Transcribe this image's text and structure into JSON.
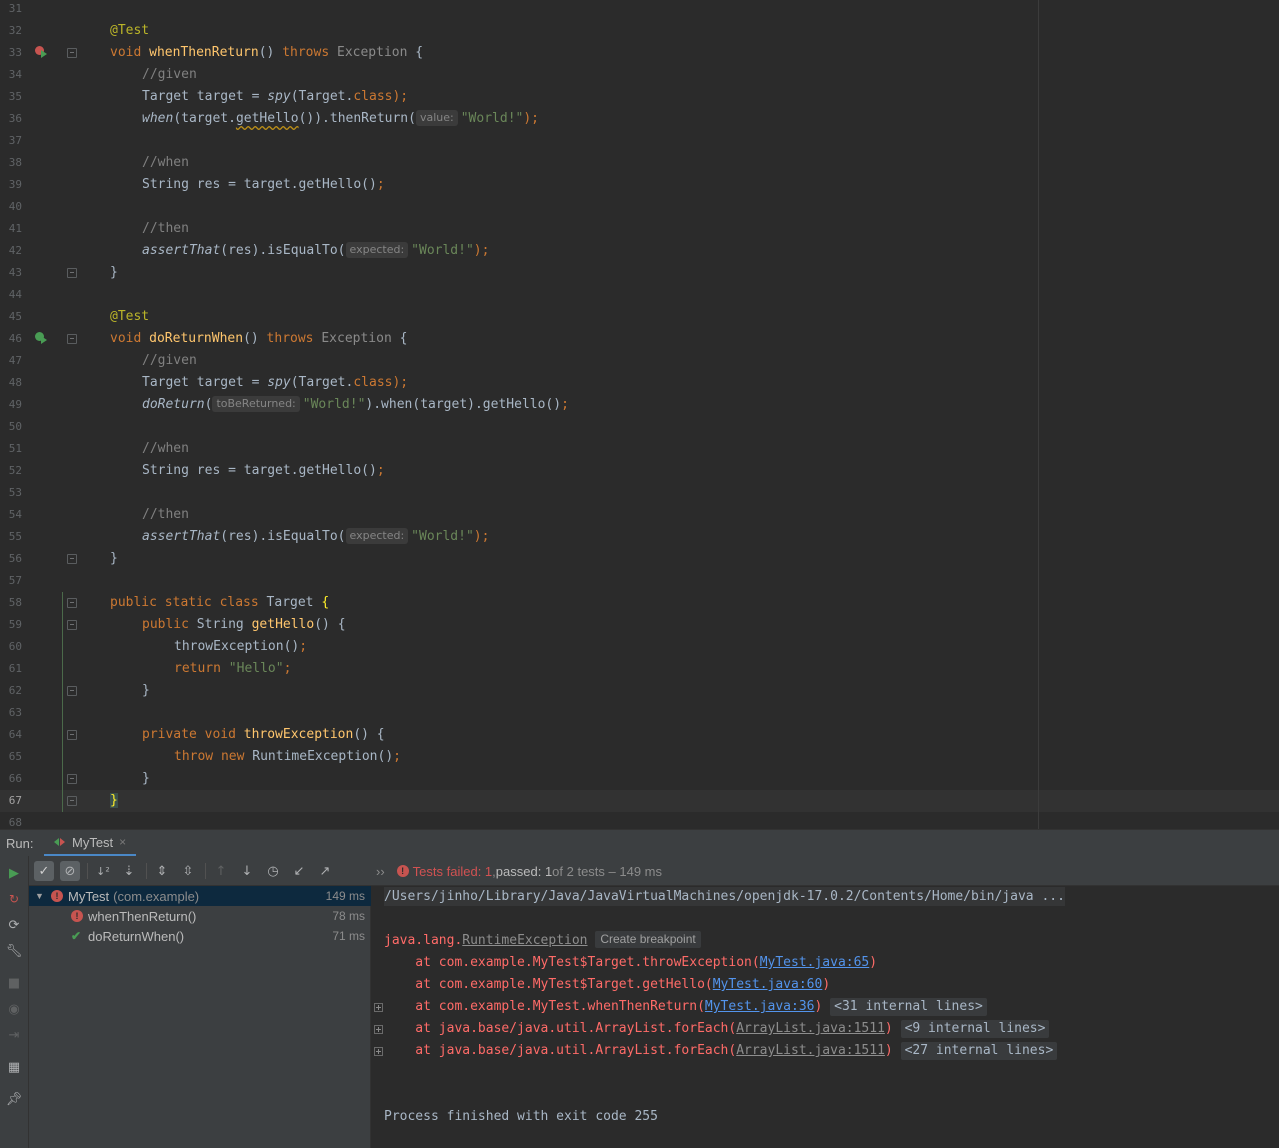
{
  "editor": {
    "line_numbers": [
      "31",
      "32",
      "33",
      "34",
      "35",
      "36",
      "37",
      "38",
      "39",
      "40",
      "41",
      "42",
      "43",
      "44",
      "45",
      "46",
      "47",
      "48",
      "49",
      "50",
      "51",
      "52",
      "53",
      "54",
      "55",
      "56",
      "57",
      "58",
      "59",
      "60",
      "61",
      "62",
      "63",
      "64",
      "65",
      "66",
      "67",
      "68"
    ],
    "current_line": "67",
    "code": {
      "l32": "@Test",
      "l33_void": "void ",
      "l33_name": "whenThenReturn",
      "l33_paren": "() ",
      "l33_throws": "throws ",
      "l33_ex": "Exception",
      "l33_brace": " {",
      "l34": "//given",
      "l35_a": "Target target = ",
      "l35_spy": "spy",
      "l35_b": "(Target.",
      "l35_class": "class",
      "l35_c": ");",
      "l36_when": "when",
      "l36_a": "(target.",
      "l36_get": "getHello",
      "l36_b": "()).thenReturn(",
      "l36_hint": "value:",
      "l36_str": "\"World!\"",
      "l36_c": ");",
      "l38": "//when",
      "l39_a": "String res = target.getHello()",
      "l39_semi": ";",
      "l41": "//then",
      "l42_assert": "assertThat",
      "l42_a": "(res).isEqualTo(",
      "l42_hint": "expected:",
      "l42_str": "\"World!\"",
      "l42_c": ");",
      "l43": "}",
      "l45": "@Test",
      "l46_void": "void ",
      "l46_name": "doReturnWhen",
      "l46_paren": "() ",
      "l46_throws": "throws ",
      "l46_ex": "Exception",
      "l46_brace": " {",
      "l47": "//given",
      "l48_a": "Target target = ",
      "l48_spy": "spy",
      "l48_b": "(Target.",
      "l48_class": "class",
      "l48_c": ");",
      "l49_doreturn": "doReturn",
      "l49_a": "(",
      "l49_hint": "toBeReturned:",
      "l49_str": "\"World!\"",
      "l49_b": ").when(target).getHello()",
      "l49_semi": ";",
      "l51": "//when",
      "l52_a": "String res = target.getHello()",
      "l52_semi": ";",
      "l54": "//then",
      "l55_assert": "assertThat",
      "l55_a": "(res).isEqualTo(",
      "l55_hint": "expected:",
      "l55_str": "\"World!\"",
      "l55_c": ");",
      "l56": "}",
      "l58_kw": "public static class ",
      "l58_name": "Target ",
      "l58_brace": "{",
      "l59_kw": "public ",
      "l59_type": "String ",
      "l59_name": "getHello",
      "l59_rest": "() {",
      "l60_a": "throwException()",
      "l60_semi": ";",
      "l61_kw": "return ",
      "l61_str": "\"Hello\"",
      "l61_semi": ";",
      "l62": "}",
      "l64_kw": "private void ",
      "l64_name": "throwException",
      "l64_rest": "() {",
      "l65_kw": "throw new ",
      "l65_a": "RuntimeException()",
      "l65_semi": ";",
      "l66": "}",
      "l67": "}"
    }
  },
  "run": {
    "title": "Run:",
    "tab_label": "MyTest",
    "tab_close": "×",
    "status": {
      "failed": "Tests failed: 1",
      "sep": ", ",
      "passed": "passed: 1",
      "rest": " of 2 tests – 149 ms"
    },
    "tree": [
      {
        "name": "MyTest",
        "pkg": "(com.example)",
        "time": "149 ms"
      },
      {
        "name": "whenThenReturn()",
        "time": "78 ms"
      },
      {
        "name": "doReturnWhen()",
        "time": "71 ms"
      }
    ],
    "console": {
      "cmd": "/Users/jinho/Library/Java/JavaVirtualMachines/openjdk-17.0.2/Contents/Home/bin/java ...",
      "exc_prefix": "java.lang.",
      "exc_name": "RuntimeException",
      "create_bp": "Create breakpoint",
      "frames": [
        {
          "pre": "    at com.example.MyTest$Target.throwException(",
          "link": "MyTest.java:65",
          "post": ")",
          "internal": ""
        },
        {
          "pre": "    at com.example.MyTest$Target.getHello(",
          "link": "MyTest.java:60",
          "post": ")",
          "internal": ""
        },
        {
          "pre": "    at com.example.MyTest.whenThenReturn(",
          "link": "MyTest.java:36",
          "post": ")",
          "internal": "<31 internal lines>"
        },
        {
          "pre": "    at java.base/java.util.ArrayList.forEach(",
          "link": "ArrayList.java:1511",
          "post": ")",
          "internal": "<9 internal lines>"
        },
        {
          "pre": "    at java.base/java.util.ArrayList.forEach(",
          "link": "ArrayList.java:1511",
          "post": ")",
          "internal": "<27 internal lines>"
        }
      ],
      "exit": "Process finished with exit code 255"
    }
  }
}
